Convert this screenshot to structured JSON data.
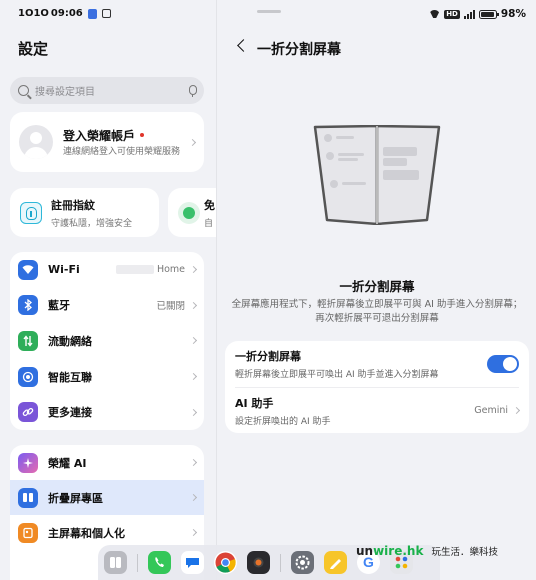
{
  "left_status": {
    "carrier": "1O1O",
    "time": "09:06"
  },
  "settings": {
    "title": "設定",
    "search_placeholder": "搜尋設定項目",
    "account": {
      "title": "登入榮耀帳戶",
      "subtitle": "連線網絡登入可使用榮耀服務"
    },
    "quick": [
      {
        "title": "註冊指紋",
        "subtitle": "守護私隱，增強安全"
      },
      {
        "title": "免",
        "subtitle": "自"
      }
    ],
    "connectivity": [
      {
        "label": "Wi-Fi",
        "value": "Home",
        "icon": "wifi-icon",
        "color": "#2f6fe0"
      },
      {
        "label": "藍牙",
        "value": "已關閉",
        "icon": "bluetooth-icon",
        "color": "#2f6fe0"
      },
      {
        "label": "流動網絡",
        "value": "",
        "icon": "mobile-data-icon",
        "color": "#2fae5a"
      },
      {
        "label": "智能互聯",
        "value": "",
        "icon": "smart-connect-icon",
        "color": "#2f6fe0"
      },
      {
        "label": "更多連接",
        "value": "",
        "icon": "link-icon",
        "color": "#7a55d8"
      }
    ],
    "system": [
      {
        "label": "榮耀 AI",
        "icon": "honor-ai-icon",
        "color": "#6c5ce7"
      },
      {
        "label": "折疊屏專區",
        "icon": "foldable-icon",
        "color": "#2f6fe0"
      },
      {
        "label": "主屏幕和個人化",
        "icon": "home-screen-icon",
        "color": "#f08a24"
      }
    ]
  },
  "right_status": {
    "sim": "HD",
    "battery": "98%"
  },
  "detail": {
    "title": "一折分割屏幕",
    "hero_title": "一折分割屏幕",
    "hero_desc": "全屏幕應用程式下，輕折屏幕後立即展平可與 AI 助手進入分割屏幕；再次輕折展平可退出分割屏幕",
    "options": [
      {
        "title": "一折分割屏幕",
        "subtitle": "輕折屏幕後立即展平可喚出 AI 助手並進入分割屏幕",
        "toggle_on": true
      },
      {
        "title": "AI 助手",
        "subtitle": "設定折屏喚出的 AI 助手",
        "value": "Gemini"
      }
    ]
  },
  "dock": {
    "apps": [
      "multitask-icon",
      "phone-icon",
      "messages-icon",
      "chrome-icon",
      "camera-icon",
      "settings-icon",
      "notes-icon",
      "google-icon",
      "apps-folder-icon"
    ]
  },
  "watermark": {
    "brand_part1": "un",
    "brand_part2": "wire",
    "brand_part3": ".hk",
    "tagline": "玩生活．樂科技"
  },
  "colors": {
    "accent": "#2f6fe0",
    "selected_row": "#dfe8fb",
    "background": "#f1f2f6"
  }
}
